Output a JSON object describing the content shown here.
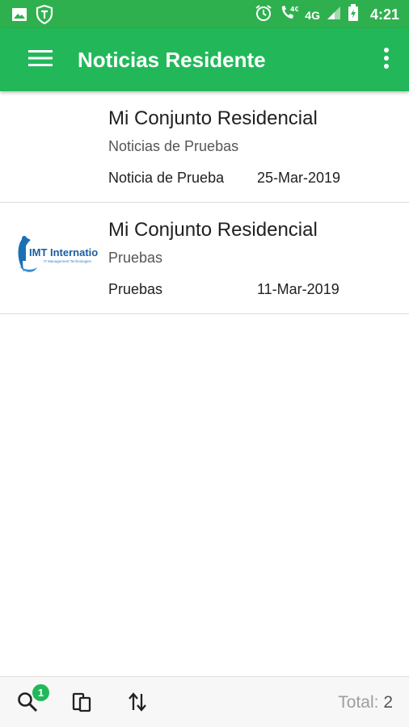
{
  "status_bar": {
    "time": "4:21",
    "network": "4G",
    "icons": [
      "image-icon",
      "shield-icon",
      "alarm-icon",
      "wifi-call-icon",
      "signal-icon",
      "battery-icon"
    ]
  },
  "app_bar": {
    "title": "Noticias Residente",
    "menu_icon": "hamburger-menu-icon",
    "more_icon": "more-vert-icon"
  },
  "colors": {
    "primary": "#22b85a",
    "status_bar": "#2fb04f"
  },
  "news": [
    {
      "title": "Mi Conjunto Residencial",
      "subtitle": "Noticias de Pruebas",
      "tag": "Noticia de Prueba",
      "date": "25-Mar-2019",
      "has_logo": false
    },
    {
      "title": "Mi Conjunto Residencial",
      "subtitle": "Pruebas",
      "tag": "Pruebas",
      "date": "11-Mar-2019",
      "has_logo": true,
      "logo_text": "IMT International",
      "logo_subtext": "IT Management Technologies"
    }
  ],
  "bottom_bar": {
    "search_badge": "1",
    "total_label": "Total:",
    "total_value": "2",
    "icons": [
      "search-icon",
      "copy-icon",
      "sort-icon"
    ]
  }
}
